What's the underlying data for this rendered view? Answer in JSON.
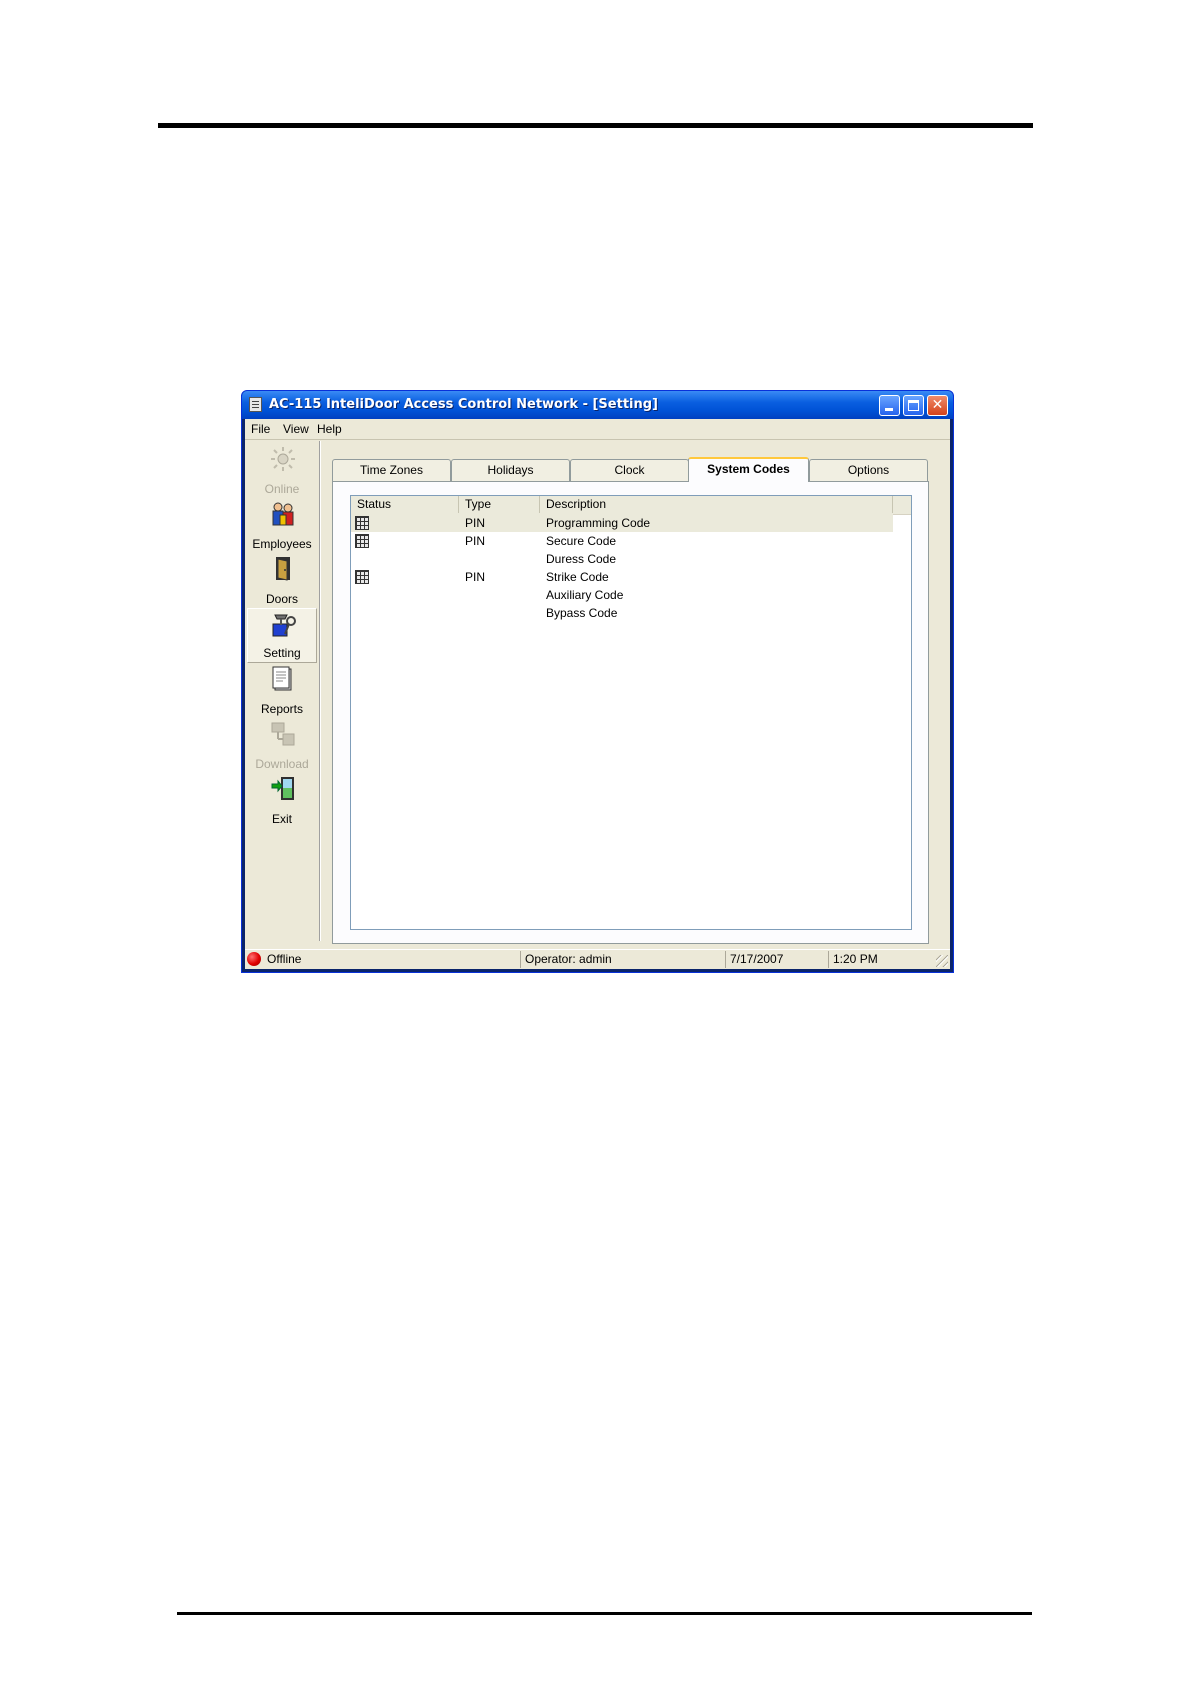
{
  "window": {
    "title": "AC-115 InteliDoor Access Control Network - [Setting]"
  },
  "menu": [
    "File",
    "View",
    "Help"
  ],
  "sidebar": {
    "items": [
      {
        "label": "Online",
        "icon": "online-icon",
        "disabled": true
      },
      {
        "label": "Employees",
        "icon": "employees-icon"
      },
      {
        "label": "Doors",
        "icon": "door-icon"
      },
      {
        "label": "Setting",
        "icon": "setting-icon",
        "active": true
      },
      {
        "label": "Reports",
        "icon": "reports-icon"
      },
      {
        "label": "Download",
        "icon": "download-icon",
        "disabled": true
      },
      {
        "label": "Exit",
        "icon": "exit-icon"
      }
    ]
  },
  "tabs": [
    {
      "label": "Time Zones"
    },
    {
      "label": "Holidays"
    },
    {
      "label": "Clock"
    },
    {
      "label": "System Codes",
      "active": true
    },
    {
      "label": "Options"
    }
  ],
  "table": {
    "columns": [
      "Status",
      "Type",
      "Description"
    ],
    "rows": [
      {
        "status_icon": true,
        "type": "PIN",
        "description": "Programming Code",
        "selected": true
      },
      {
        "status_icon": true,
        "type": "PIN",
        "description": "Secure Code"
      },
      {
        "status_icon": false,
        "type": "",
        "description": "Duress Code"
      },
      {
        "status_icon": true,
        "type": "PIN",
        "description": "Strike Code"
      },
      {
        "status_icon": false,
        "type": "",
        "description": "Auxiliary Code"
      },
      {
        "status_icon": false,
        "type": "",
        "description": "Bypass Code"
      }
    ]
  },
  "status": {
    "connection": "Offline",
    "operator": "Operator: admin",
    "date": "7/17/2007",
    "time": "1:20 PM",
    "connection_color": "#e00000"
  },
  "colors": {
    "titlebar": "#0052d6",
    "window_bg": "#ece9d8",
    "active_tab_accent": "#ffc83c"
  }
}
